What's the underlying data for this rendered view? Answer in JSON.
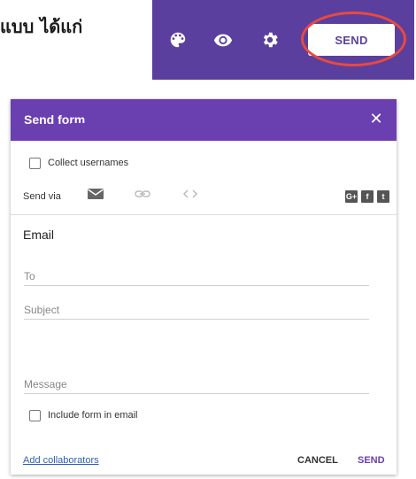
{
  "caption": "แบบ ได้แก่",
  "toolbar": {
    "icons": [
      "palette-icon",
      "eye-icon",
      "gear-icon"
    ],
    "send_label": "SEND",
    "accent": "#5b3f9f",
    "highlight_color": "#e84a3d"
  },
  "dialog": {
    "title": "Send form",
    "close_icon": "close-icon",
    "collect_usernames_label": "Collect usernames",
    "send_via_label": "Send via",
    "tabs": [
      "email-icon",
      "link-icon",
      "embed-icon"
    ],
    "social": [
      "G+",
      "f",
      "t"
    ],
    "section_title": "Email",
    "fields": {
      "to_placeholder": "To",
      "subject_placeholder": "Subject",
      "message_placeholder": "Message"
    },
    "include_form_label": "Include form in email",
    "add_collaborators_label": "Add collaborators",
    "cancel_label": "CANCEL",
    "send_label": "SEND",
    "header_color": "#6a3fb0"
  }
}
